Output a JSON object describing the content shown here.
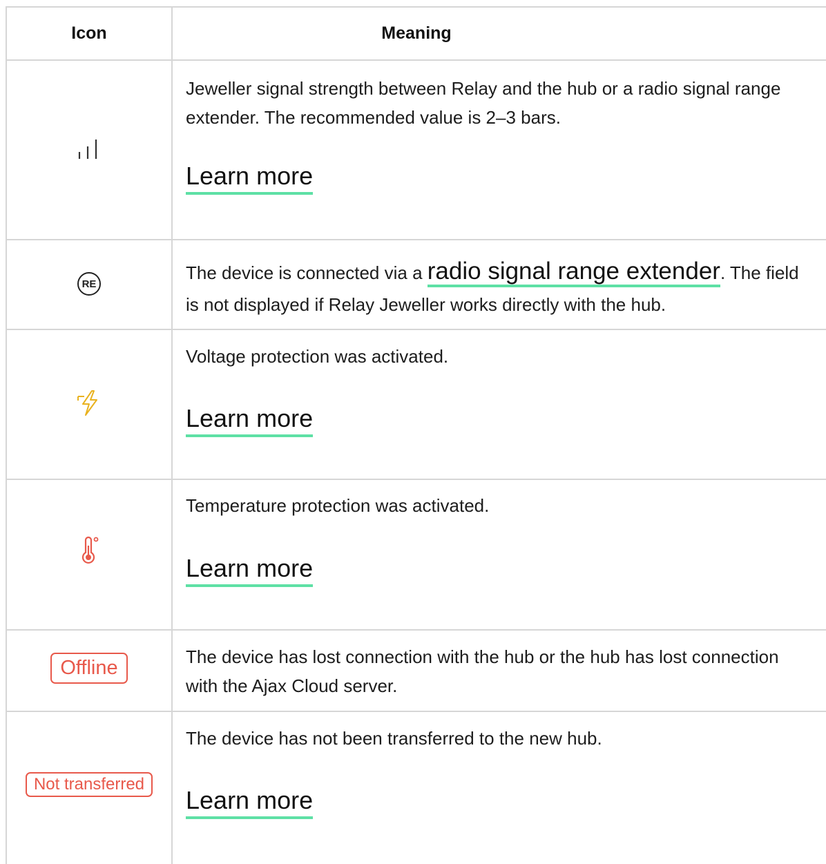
{
  "header": {
    "icon": "Icon",
    "meaning": "Meaning"
  },
  "rows": [
    {
      "icon": "signal-strength-icon",
      "text": "Jeweller signal strength between Relay and the hub or a radio signal range extender. The recommended value is 2–3 bars.",
      "link": "Learn more"
    },
    {
      "icon": "range-extender-icon",
      "icon_label": "RE",
      "text_before": "The device is connected via a ",
      "link": "radio signal range extender",
      "text_after": ". The field is not displayed if Relay Jeweller works directly with the hub."
    },
    {
      "icon": "voltage-protection-icon",
      "text": "Voltage protection was activated.",
      "link": "Learn more"
    },
    {
      "icon": "temperature-protection-icon",
      "text": "Temperature protection was activated.",
      "link": "Learn more"
    },
    {
      "icon": "offline-badge",
      "badge": "Offline",
      "text": "The device has lost connection with the hub or the hub has lost connection with the Ajax Cloud server."
    },
    {
      "icon": "not-transferred-badge",
      "badge": "Not transferred",
      "text": "The device has not been transferred to the new hub.",
      "link": "Learn more"
    }
  ],
  "colors": {
    "link_underline": "#5ee0a5",
    "badge": "#e8594b",
    "voltage_icon": "#e9b21f",
    "temperature_icon": "#e8594b",
    "border": "#d6d6d6"
  }
}
